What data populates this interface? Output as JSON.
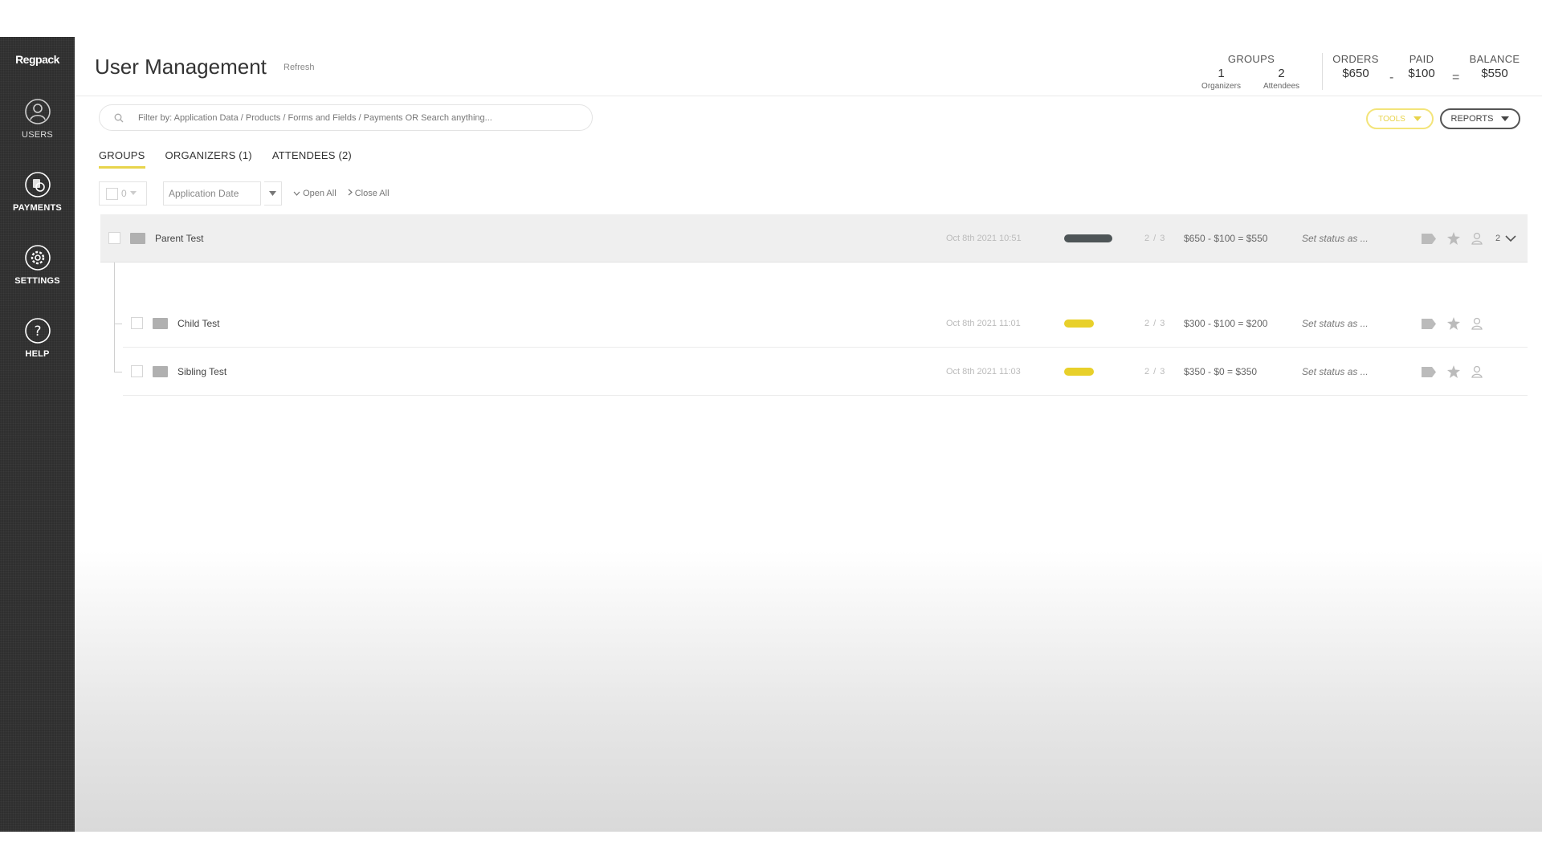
{
  "app": {
    "logo_text": "Regpack"
  },
  "sidebar": {
    "items": [
      {
        "label": "USERS",
        "icon": "user-icon"
      },
      {
        "label": "PAYMENTS",
        "icon": "payments-icon"
      },
      {
        "label": "SETTINGS",
        "icon": "gear-icon"
      },
      {
        "label": "HELP",
        "icon": "help-icon"
      }
    ]
  },
  "header": {
    "title": "User Management",
    "refresh_label": "Refresh",
    "groups": {
      "label": "GROUPS",
      "organizers_count": "1",
      "organizers_label": "Organizers",
      "attendees_count": "2",
      "attendees_label": "Attendees"
    },
    "orders": {
      "label": "ORDERS",
      "value": "$650"
    },
    "paid": {
      "label": "PAID",
      "value": "$100"
    },
    "balance": {
      "label": "BALANCE",
      "value": "$550"
    },
    "minus_sign": "-",
    "equals_sign": "="
  },
  "search": {
    "placeholder": "Filter by: Application Data / Products / Forms and Fields / Payments OR Search anything..."
  },
  "toolbar_buttons": {
    "tools_label": "TOOLS",
    "reports_label": "REPORTS"
  },
  "tabs": [
    {
      "label": "GROUPS",
      "active": true
    },
    {
      "label": "ORGANIZERS (1)",
      "active": false
    },
    {
      "label": "ATTENDEES (2)",
      "active": false
    }
  ],
  "list_toolbar": {
    "select_count": "0",
    "sort_value": "Application Date",
    "open_all": "Open All",
    "close_all": "Close All"
  },
  "rows": [
    {
      "name": "Parent Test",
      "date": "Oct 8th 2021 10:51",
      "ratio": "2 / 3",
      "billing": "$650 - $100 = $550",
      "status": "Set status as ...",
      "count": "2",
      "bar_color": "#4e5557"
    },
    {
      "name": "Child Test",
      "date": "Oct 8th 2021 11:01",
      "ratio": "2 / 3",
      "billing": "$300 - $100 = $200",
      "status": "Set status as ...",
      "bar_color": "#e8d02a"
    },
    {
      "name": "Sibling Test",
      "date": "Oct 8th 2021 11:03",
      "ratio": "2 / 3",
      "billing": "$350 - $0 = $350",
      "status": "Set status as ...",
      "bar_color": "#e8d02a"
    }
  ]
}
